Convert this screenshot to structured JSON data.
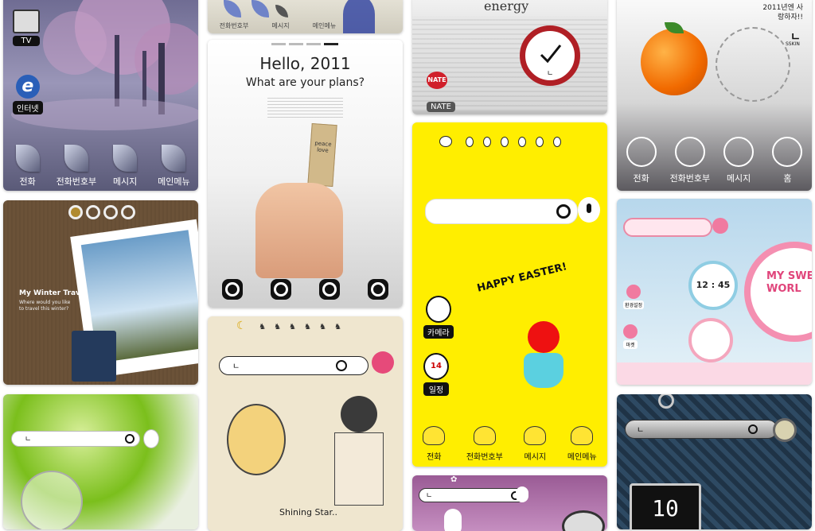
{
  "tiles": {
    "winter_tree": {
      "tv_label": "TV",
      "internet_label": "인터넷",
      "dock": [
        "전화",
        "전화번호부",
        "메시지",
        "메인메뉴"
      ]
    },
    "iris": {
      "dock": [
        "전화번호부",
        "메시지",
        "메인메뉴"
      ]
    },
    "energy": {
      "word": "energy",
      "nate_label": "NATE",
      "clock_letter": "ㄴ"
    },
    "orange": {
      "corner_text": "2011년엔 사랑하자!!",
      "brand_logo": "ㄴ",
      "brand": "SSKIN",
      "dock": [
        "전화",
        "전화번호부",
        "메시지",
        "홈"
      ]
    },
    "hello": {
      "title": "Hello, 2011",
      "subtitle": "What are your plans?",
      "tag": "peace love"
    },
    "easter": {
      "search_letter": "",
      "camera_label": "카메라",
      "calendar_label": "일정",
      "calendar_day": "14",
      "banner": "HAPPY EASTER!",
      "dock": [
        "전화",
        "전화번호부",
        "메시지",
        "메인메뉴"
      ]
    },
    "winter_travel": {
      "title": "My Winter Travel",
      "subtitle": "Where would you like to travel this winter?"
    },
    "sweet": {
      "time": "12 : 45",
      "headline": "MY SWE WORL",
      "label1": "환경설정",
      "label2": "마켓"
    },
    "shining": {
      "search_letter": "ㄴ",
      "caption": "Shining Star.."
    },
    "green": {
      "search_letter": "ㄴ"
    },
    "pink_bottom": {
      "search_letter": "ㄴ"
    },
    "croc": {
      "search_letter": "ㄴ",
      "clock_digits": "10"
    }
  }
}
